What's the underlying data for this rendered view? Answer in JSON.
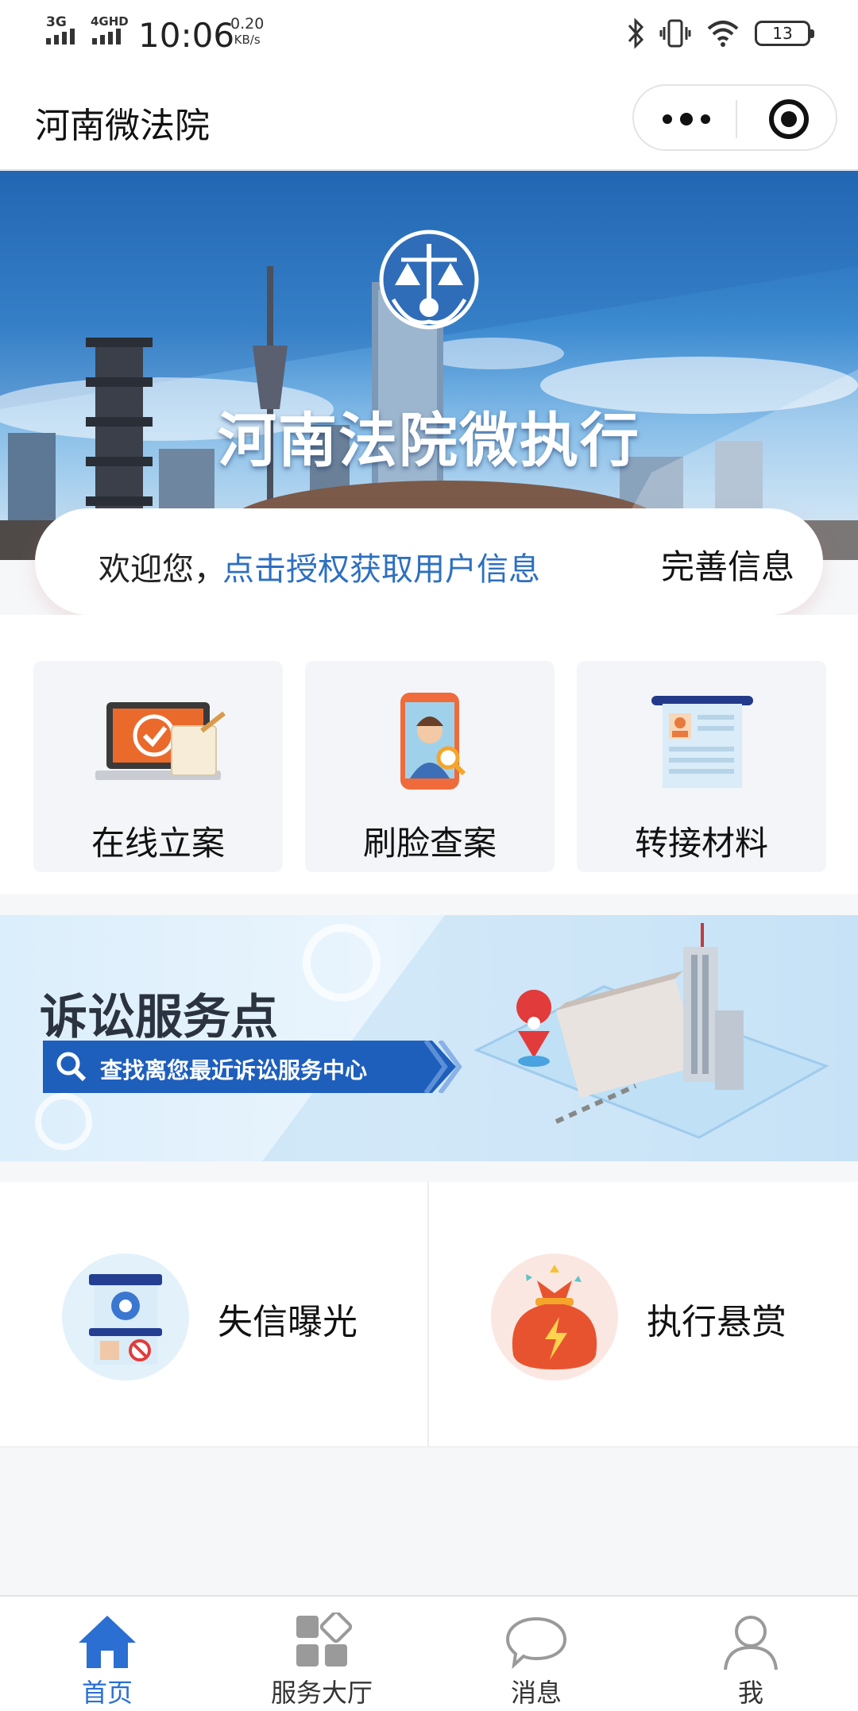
{
  "status_bar": {
    "net1": "3G",
    "net2": "4GHD",
    "time": "10:06",
    "speed_value": "0.20",
    "speed_unit": "KB/s",
    "battery": "13"
  },
  "nav": {
    "title": "河南微法院"
  },
  "hero": {
    "title": "河南法院微执行"
  },
  "welcome": {
    "greeting": "欢迎您，",
    "auth_link": "点击授权获取用户信息",
    "complete_label": "完善信息"
  },
  "tiles": [
    {
      "label": "在线立案",
      "icon": "laptop-check-icon"
    },
    {
      "label": "刷脸查案",
      "icon": "phone-face-search-icon"
    },
    {
      "label": "转接材料",
      "icon": "document-transfer-icon"
    }
  ],
  "litigation": {
    "title": "诉讼服务点",
    "subtitle": "查找离您最近诉讼服务中心"
  },
  "services": [
    {
      "label": "失信曝光",
      "icon": "exposure-board-icon"
    },
    {
      "label": "执行悬赏",
      "icon": "money-bag-icon"
    }
  ],
  "tabbar": [
    {
      "label": "首页",
      "icon": "home-icon"
    },
    {
      "label": "服务大厅",
      "icon": "service-grid-icon"
    },
    {
      "label": "消息",
      "icon": "message-bubble-icon"
    },
    {
      "label": "我",
      "icon": "profile-icon"
    }
  ],
  "colors": {
    "accent": "#2a6fd1",
    "link": "#2e6fc0",
    "banner_blue": "#1e5fbc",
    "tile_bg": "#f3f5f8",
    "reward_orange": "#e8532f"
  }
}
